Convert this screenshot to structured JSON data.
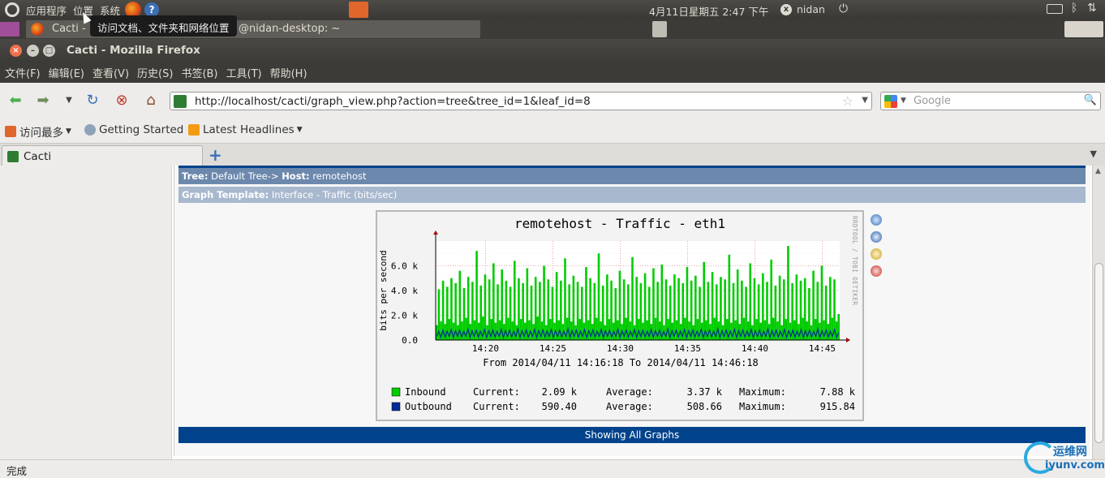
{
  "top_panel": {
    "apps": "应用程序",
    "places": "位置",
    "system": "系统",
    "clock": "4月11日星期五  2:47 下午",
    "user": "nidan"
  },
  "tooltip": "访问文档、文件夹和网络位置",
  "taskbar": {
    "firefox_task": "Cacti -",
    "terminal_task": "@nidan-desktop: ~"
  },
  "window": {
    "title": "Cacti - Mozilla Firefox"
  },
  "menu": [
    "文件(F)",
    "编辑(E)",
    "查看(V)",
    "历史(S)",
    "书签(B)",
    "工具(T)",
    "帮助(H)"
  ],
  "nav": {
    "url": "http://localhost/cacti/graph_view.php?action=tree&tree_id=1&leaf_id=8",
    "search_placeholder": "Google"
  },
  "bookmarks": [
    "访问最多",
    "Getting Started",
    "Latest Headlines"
  ],
  "tab": {
    "label": "Cacti"
  },
  "cacti": {
    "tree_label": "Tree:",
    "tree_value": "Default Tree->",
    "host_label": "Host:",
    "host_value": "remotehost",
    "template_label": "Graph Template:",
    "template_value": "Interface - Traffic (bits/sec)",
    "showing_all": "Showing All Graphs"
  },
  "chart_data": {
    "type": "area",
    "title": "remotehost - Traffic - eth1",
    "ylabel": "bits per second",
    "side_label": "RRDTOOL / TOBI OETIKER",
    "subtitle": "From 2014/04/11 14:16:18 To 2014/04/11 14:46:18",
    "y_ticks": [
      "0.0",
      "2.0 k",
      "4.0 k",
      "6.0 k"
    ],
    "ylim": [
      0,
      8000
    ],
    "x_ticks": [
      "14:20",
      "14:25",
      "14:30",
      "14:35",
      "14:40",
      "14:45"
    ],
    "series": [
      {
        "name": "Inbound",
        "color": "#00cc00",
        "current": "2.09 k",
        "average": "3.37 k",
        "maximum": "7.88 k",
        "values": [
          1200,
          4100,
          1500,
          4800,
          1300,
          4300,
          1700,
          5000,
          1400,
          4600,
          1200,
          5600,
          1500,
          4200,
          1800,
          5100,
          1300,
          4700,
          1600,
          7200,
          1400,
          4400,
          1900,
          5300,
          1200,
          4900,
          1700,
          6200,
          1400,
          4500,
          1600,
          5700,
          1300,
          4800,
          1800,
          4300,
          1500,
          6400,
          1200,
          5000,
          1700,
          4600,
          1400,
          5800,
          1600,
          4400,
          1300,
          5100,
          1900,
          4700,
          1500,
          6000,
          1200,
          4900,
          1700,
          4300,
          1400,
          5500,
          1600,
          4800,
          1300,
          6600,
          1800,
          4500,
          1500,
          5200,
          1200,
          4700,
          1700,
          4300,
          1400,
          5900,
          1600,
          5000,
          1300,
          4600,
          1800,
          7000,
          1500,
          4400,
          1200,
          5300,
          1700,
          4800,
          1400,
          4200,
          1600,
          5600,
          1300,
          4900,
          1800,
          4500,
          1500,
          6700,
          1200,
          5100,
          1700,
          4600,
          1400,
          5400,
          1600,
          4300,
          1300,
          5800,
          1800,
          4700,
          1500,
          6100,
          1200,
          4900,
          1700,
          4400,
          1400,
          5300,
          1600,
          5000,
          1300,
          4600,
          1800,
          5900,
          1500,
          4800,
          1200,
          5200,
          1700,
          4300,
          1400,
          6300,
          1600,
          4700,
          1300,
          5500,
          1800,
          4500,
          1500,
          5100,
          1200,
          4900,
          1700,
          6900,
          1400,
          4600,
          1600,
          5700,
          1300,
          4800,
          1800,
          4300,
          1500,
          6200,
          1200,
          5000,
          1700,
          4500,
          1400,
          5400,
          1600,
          4700,
          1300,
          6500,
          1800,
          4400,
          1500,
          5200,
          1200,
          4900,
          1700,
          7600,
          1400,
          4600,
          1600,
          5300,
          1300,
          4800,
          1800,
          5000,
          1500,
          4200,
          1200,
          5600,
          1700,
          4700,
          1400,
          6000,
          1600,
          4400,
          1300,
          5100,
          1800,
          4900,
          1500,
          2100
        ]
      },
      {
        "name": "Outbound",
        "color": "#002a97",
        "current": "590.40",
        "average": "508.66",
        "maximum": "915.84",
        "values": [
          300,
          700,
          200,
          800,
          250,
          700,
          300,
          850,
          200,
          750,
          300,
          800,
          250,
          700,
          300,
          900,
          200,
          750,
          300,
          800,
          250,
          700,
          300,
          850,
          200,
          750,
          300,
          800,
          250,
          700,
          300,
          850,
          200,
          750,
          300,
          800,
          250,
          700,
          300,
          900,
          200,
          750,
          300,
          800,
          250,
          700,
          300,
          850,
          200,
          750,
          300,
          800,
          250,
          700,
          300,
          850,
          200,
          750,
          300,
          800,
          250,
          700,
          300,
          900,
          200,
          750,
          300,
          800,
          250,
          700,
          300,
          850,
          200,
          750,
          300,
          800,
          250,
          700,
          300,
          850,
          200,
          750,
          300,
          800,
          250,
          700,
          300,
          900,
          200,
          750,
          300,
          800,
          250,
          700,
          300,
          850,
          200,
          750,
          300,
          800,
          250,
          700,
          300,
          850,
          200,
          750,
          300,
          800,
          250,
          700,
          300,
          900,
          200,
          750,
          300,
          800,
          250,
          700,
          300,
          850,
          200,
          750,
          300,
          800,
          250,
          700,
          300,
          850,
          200,
          750,
          300,
          800,
          250,
          700,
          300,
          900,
          200,
          750,
          300,
          800,
          250,
          700,
          300,
          850,
          200,
          750,
          300,
          800,
          250,
          700,
          300,
          850,
          200,
          750,
          300,
          800,
          250,
          700,
          300,
          900,
          200,
          750,
          300,
          800,
          250,
          700,
          300,
          850,
          200,
          750,
          300,
          800,
          250,
          700,
          300,
          850,
          200,
          750,
          300,
          800,
          250,
          700,
          300,
          900,
          200,
          750,
          300,
          800,
          250,
          700,
          300,
          850,
          200,
          600
        ]
      }
    ],
    "legend_labels": {
      "current": "Current:",
      "average": "Average:",
      "maximum": "Maximum:"
    }
  },
  "status": "完成",
  "watermark": {
    "line1": "运维网",
    "line2": "iyunv.com"
  }
}
